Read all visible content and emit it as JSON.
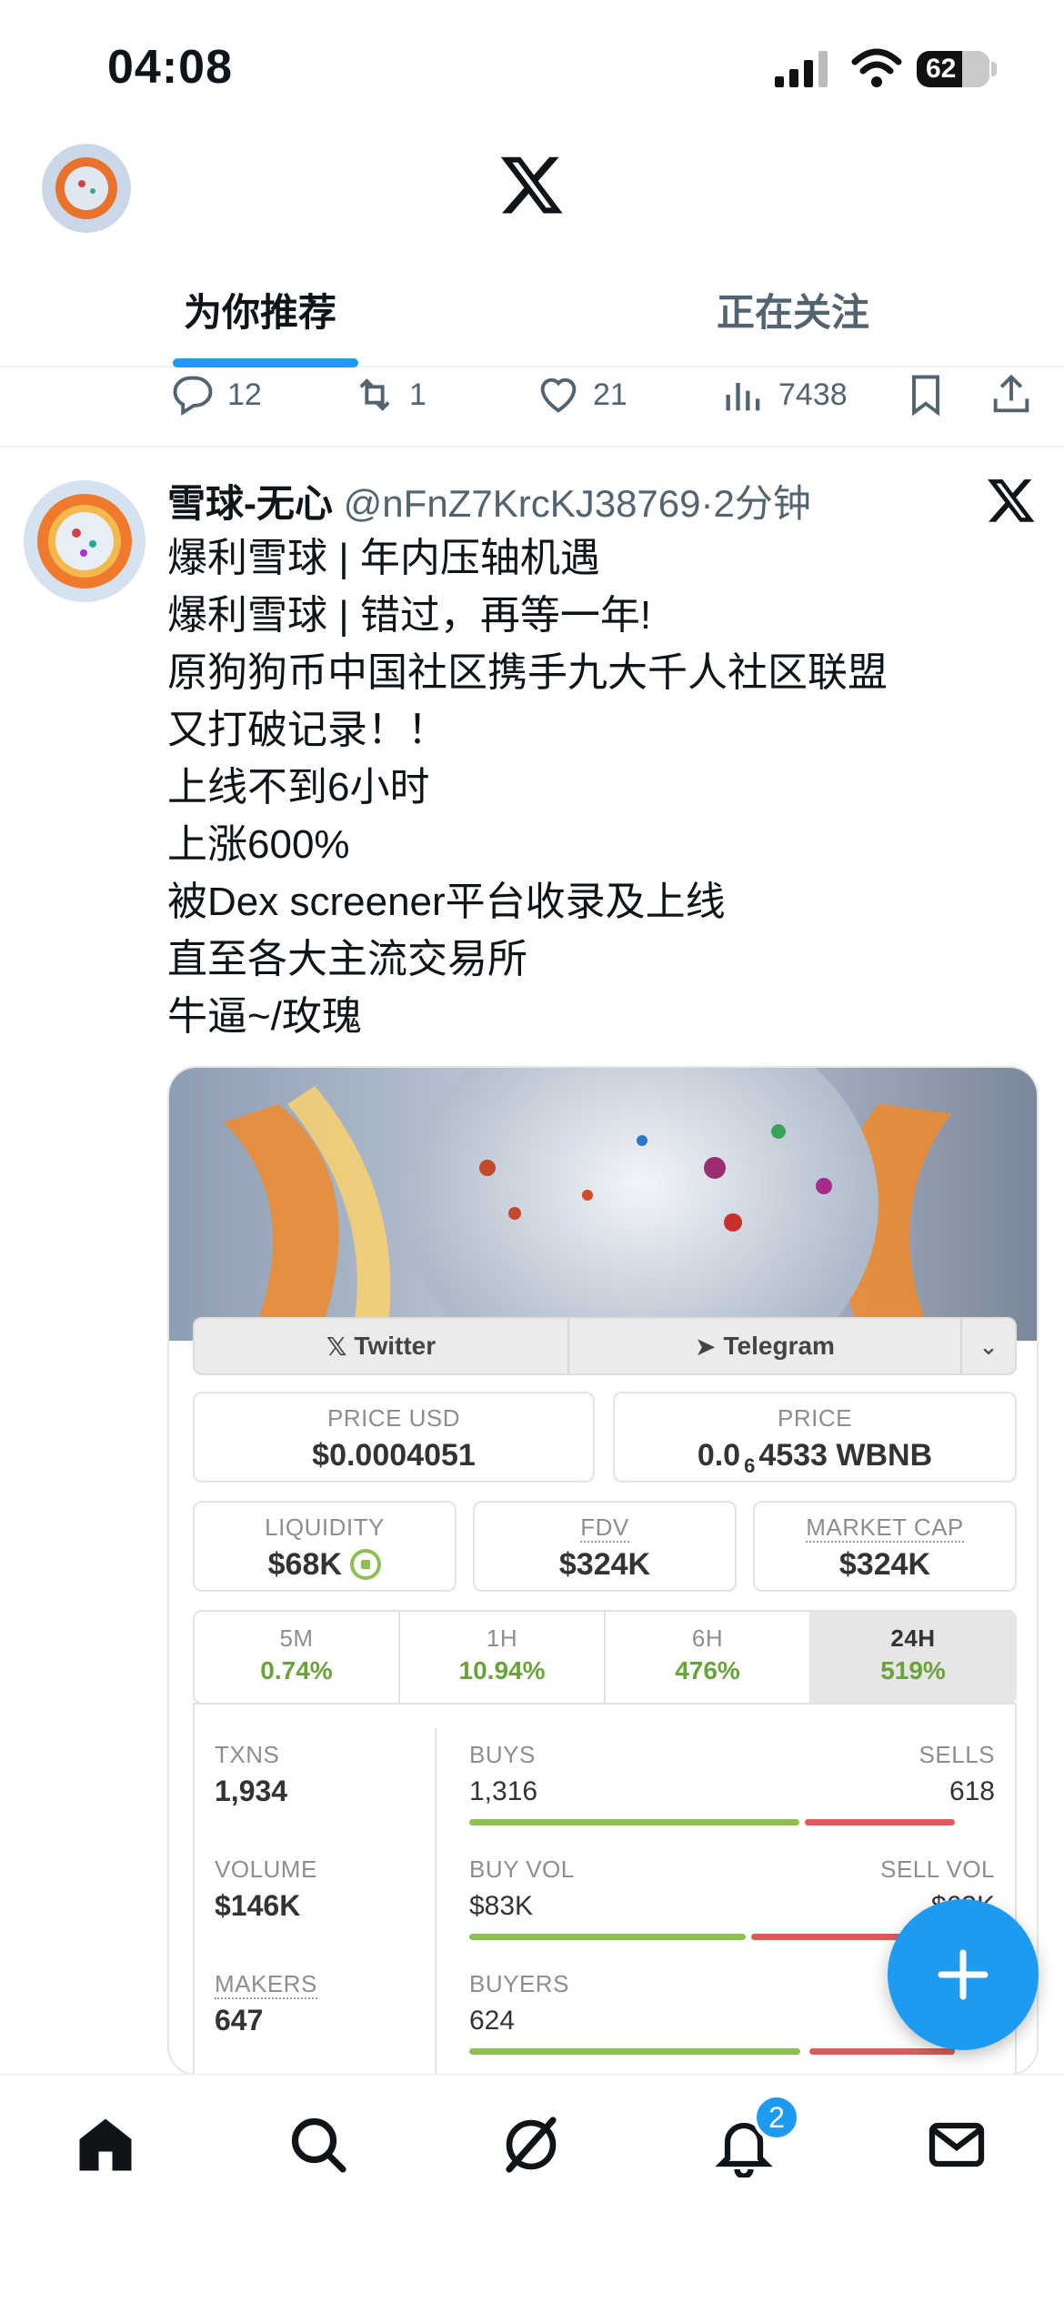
{
  "status_bar": {
    "time": "04:08",
    "battery": "62"
  },
  "header": {
    "tabs": [
      "为你推荐",
      "正在关注"
    ]
  },
  "prev_tweet_actions": {
    "replies": "12",
    "reposts": "1",
    "likes": "21",
    "views": "7438"
  },
  "tweet": {
    "name": "雪球-无心",
    "handle": "@nFnZ7KrcKJ38769",
    "time": "·2分钟",
    "lines": [
      "爆利雪球 | 年内压轴机遇",
      "爆利雪球 | 错过，再等一年!",
      "原狗狗币中国社区携手九大千人社区联盟",
      "又打破记录！！",
      "上线不到6小时",
      "上涨600%",
      "被Dex screener平台收录及上线",
      "直至各大主流交易所",
      "牛逼~/玫瑰"
    ]
  },
  "card": {
    "links": {
      "twitter": "Twitter",
      "telegram": "Telegram"
    },
    "price_usd": {
      "label": "PRICE USD",
      "value": "$0.0004051"
    },
    "price": {
      "label": "PRICE",
      "prefix": "0.0",
      "sub": "6",
      "value": "4533 WBNB"
    },
    "liquidity": {
      "label": "LIQUIDITY",
      "value": "$68K"
    },
    "fdv": {
      "label": "FDV",
      "value": "$324K"
    },
    "market_cap": {
      "label": "MARKET CAP",
      "value": "$324K"
    },
    "periods": [
      {
        "label": "5M",
        "value": "0.74%"
      },
      {
        "label": "1H",
        "value": "10.94%"
      },
      {
        "label": "6H",
        "value": "476%"
      },
      {
        "label": "24H",
        "value": "519%"
      }
    ],
    "txns": {
      "label": "TXNS",
      "value": "1,934"
    },
    "volume": {
      "label": "VOLUME",
      "value": "$146K"
    },
    "makers": {
      "label": "MAKERS",
      "value": "647"
    },
    "buys": {
      "label": "BUYS",
      "value": "1,316",
      "buy_fraction": 0.68
    },
    "sells": {
      "label": "SELLS",
      "value": "618"
    },
    "buy_vol": {
      "label": "BUY VOL",
      "value": "$83K",
      "buy_fraction": 0.57
    },
    "sell_vol": {
      "label": "SELL VOL",
      "value": "$63K"
    },
    "buyers": {
      "label": "BUYERS",
      "value": "624"
    }
  },
  "nav": {
    "notification_badge": "2"
  },
  "colors": {
    "accent": "#1d9bf0",
    "buy": "#8cc152",
    "sell": "#e05a5a"
  }
}
